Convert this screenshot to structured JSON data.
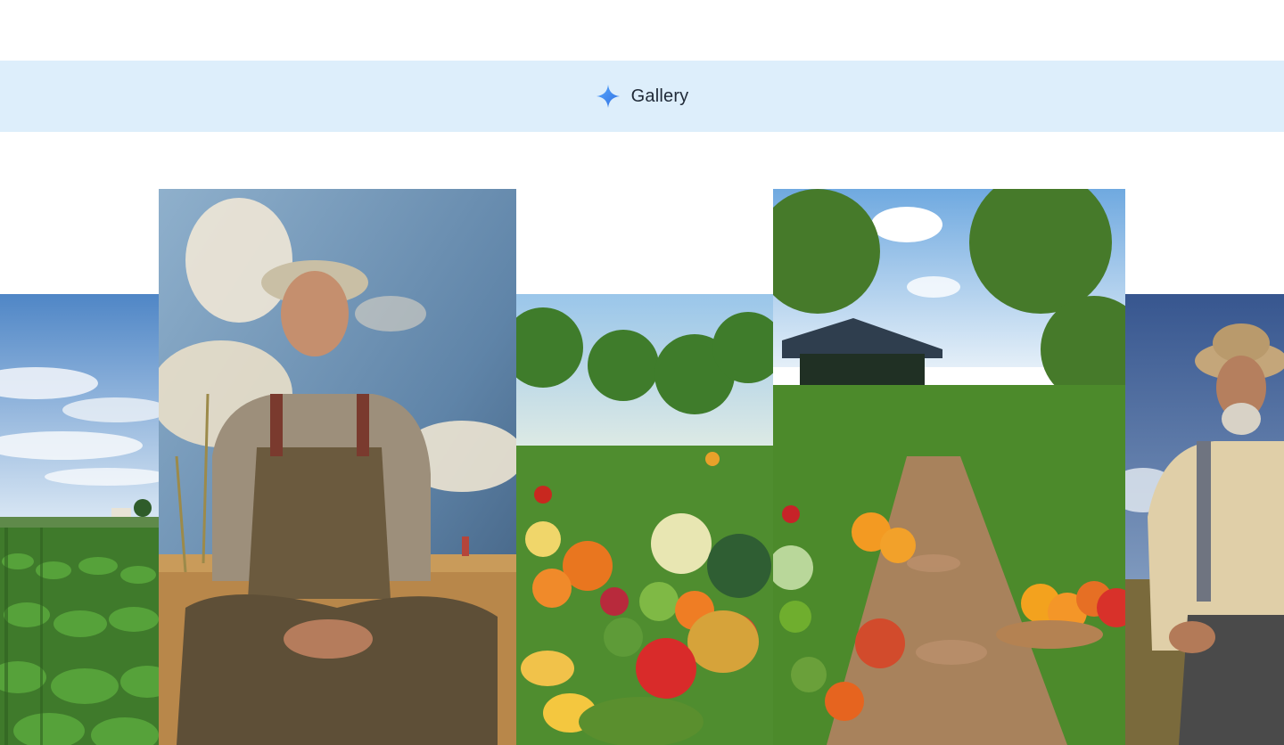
{
  "header": {
    "icon": "sparkle-icon",
    "title": "Gallery",
    "accent_color": "#3b82f6",
    "background_color": "#ddeefb"
  },
  "gallery": {
    "items": [
      {
        "subject": "field-of-crops-image"
      },
      {
        "subject": "farmer-looking-up-image"
      },
      {
        "subject": "vegetable-harvest-image"
      },
      {
        "subject": "garden-path-image"
      },
      {
        "subject": "bearded-farmer-image"
      }
    ]
  }
}
